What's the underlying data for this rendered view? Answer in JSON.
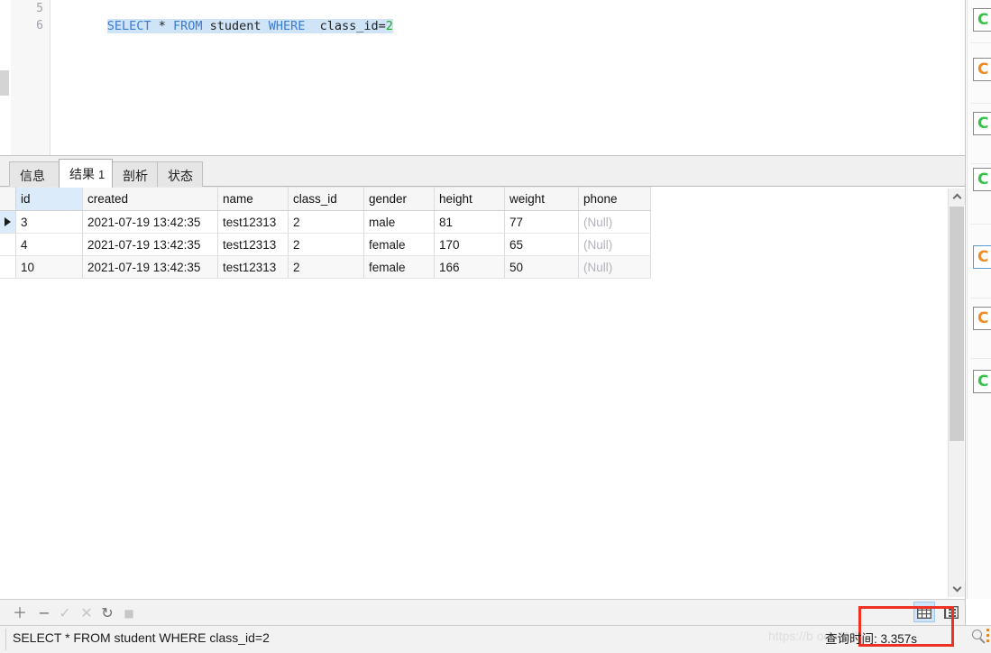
{
  "editor": {
    "line_numbers": [
      "5",
      "6"
    ],
    "sql_tokens": [
      {
        "t": "SELECT",
        "k": "kw"
      },
      {
        "t": " ",
        "k": "op"
      },
      {
        "t": "*",
        "k": "op"
      },
      {
        "t": " ",
        "k": "op"
      },
      {
        "t": "FROM",
        "k": "kw"
      },
      {
        "t": " ",
        "k": "op"
      },
      {
        "t": "student",
        "k": "idn"
      },
      {
        "t": " ",
        "k": "op"
      },
      {
        "t": "WHERE",
        "k": "kw"
      },
      {
        "t": "  ",
        "k": "op"
      },
      {
        "t": "class_id",
        "k": "idn"
      },
      {
        "t": "=",
        "k": "op"
      },
      {
        "t": "2",
        "k": "num"
      }
    ],
    "sql_plain": "SELECT * FROM student WHERE  class_id=2"
  },
  "tabs": [
    {
      "label": "信息",
      "count": "",
      "active": false
    },
    {
      "label": "结果",
      "count": "1",
      "active": true
    },
    {
      "label": "剖析",
      "count": "",
      "active": false
    },
    {
      "label": "状态",
      "count": "",
      "active": false
    }
  ],
  "grid": {
    "columns": [
      "id",
      "created",
      "name",
      "class_id",
      "gender",
      "height",
      "weight",
      "phone"
    ],
    "selected_column": "id",
    "current_row_index": 0,
    "rows": [
      {
        "id": "3",
        "created": "2021-07-19 13:42:35",
        "name": "test12313",
        "class_id": "2",
        "gender": "male",
        "height": "81",
        "weight": "77",
        "phone": "(Null)"
      },
      {
        "id": "4",
        "created": "2021-07-19 13:42:35",
        "name": "test12313",
        "class_id": "2",
        "gender": "female",
        "height": "170",
        "weight": "65",
        "phone": "(Null)"
      },
      {
        "id": "10",
        "created": "2021-07-19 13:42:35",
        "name": "test12313",
        "class_id": "2",
        "gender": "female",
        "height": "166",
        "weight": "50",
        "phone": "(Null)"
      }
    ]
  },
  "toolbar": {
    "icons": [
      {
        "name": "add-record-icon",
        "glyph": "＋",
        "disabled": false
      },
      {
        "name": "delete-record-icon",
        "glyph": "−",
        "disabled": false
      },
      {
        "name": "apply-change-icon",
        "glyph": "✓",
        "disabled": true
      },
      {
        "name": "cancel-change-icon",
        "glyph": "✕",
        "disabled": true
      },
      {
        "name": "refresh-icon",
        "glyph": "↻",
        "disabled": false
      },
      {
        "name": "stop-icon",
        "glyph": "■",
        "disabled": true
      }
    ],
    "grid_view_label": "grid-view-icon",
    "form_view_label": "form-view-icon"
  },
  "status": {
    "sql": "SELECT * FROM student WHERE  class_id=2",
    "query_time": "查询时间: 3.357s",
    "watermark": "https://b            oda118"
  },
  "sidebar": {
    "items": [
      {
        "glyph": "C",
        "color": "#36c24a",
        "selected": false
      },
      {
        "glyph": "C",
        "color": "#f08a22",
        "selected": false
      },
      {
        "glyph": "C",
        "color": "#36c24a",
        "selected": false
      },
      {
        "glyph": "C",
        "color": "#36c24a",
        "selected": false
      },
      {
        "glyph": "C",
        "color": "#f08a22",
        "selected": true
      },
      {
        "glyph": "C",
        "color": "#f08a22",
        "selected": false
      },
      {
        "glyph": "C",
        "color": "#36c24a",
        "selected": false
      }
    ]
  },
  "colors": {
    "keyword": "#3a7bd5",
    "number": "#12b312",
    "selection": "#cfe4f7",
    "highlight_box": "#ef3124",
    "selected_header": "#dcebf9"
  }
}
